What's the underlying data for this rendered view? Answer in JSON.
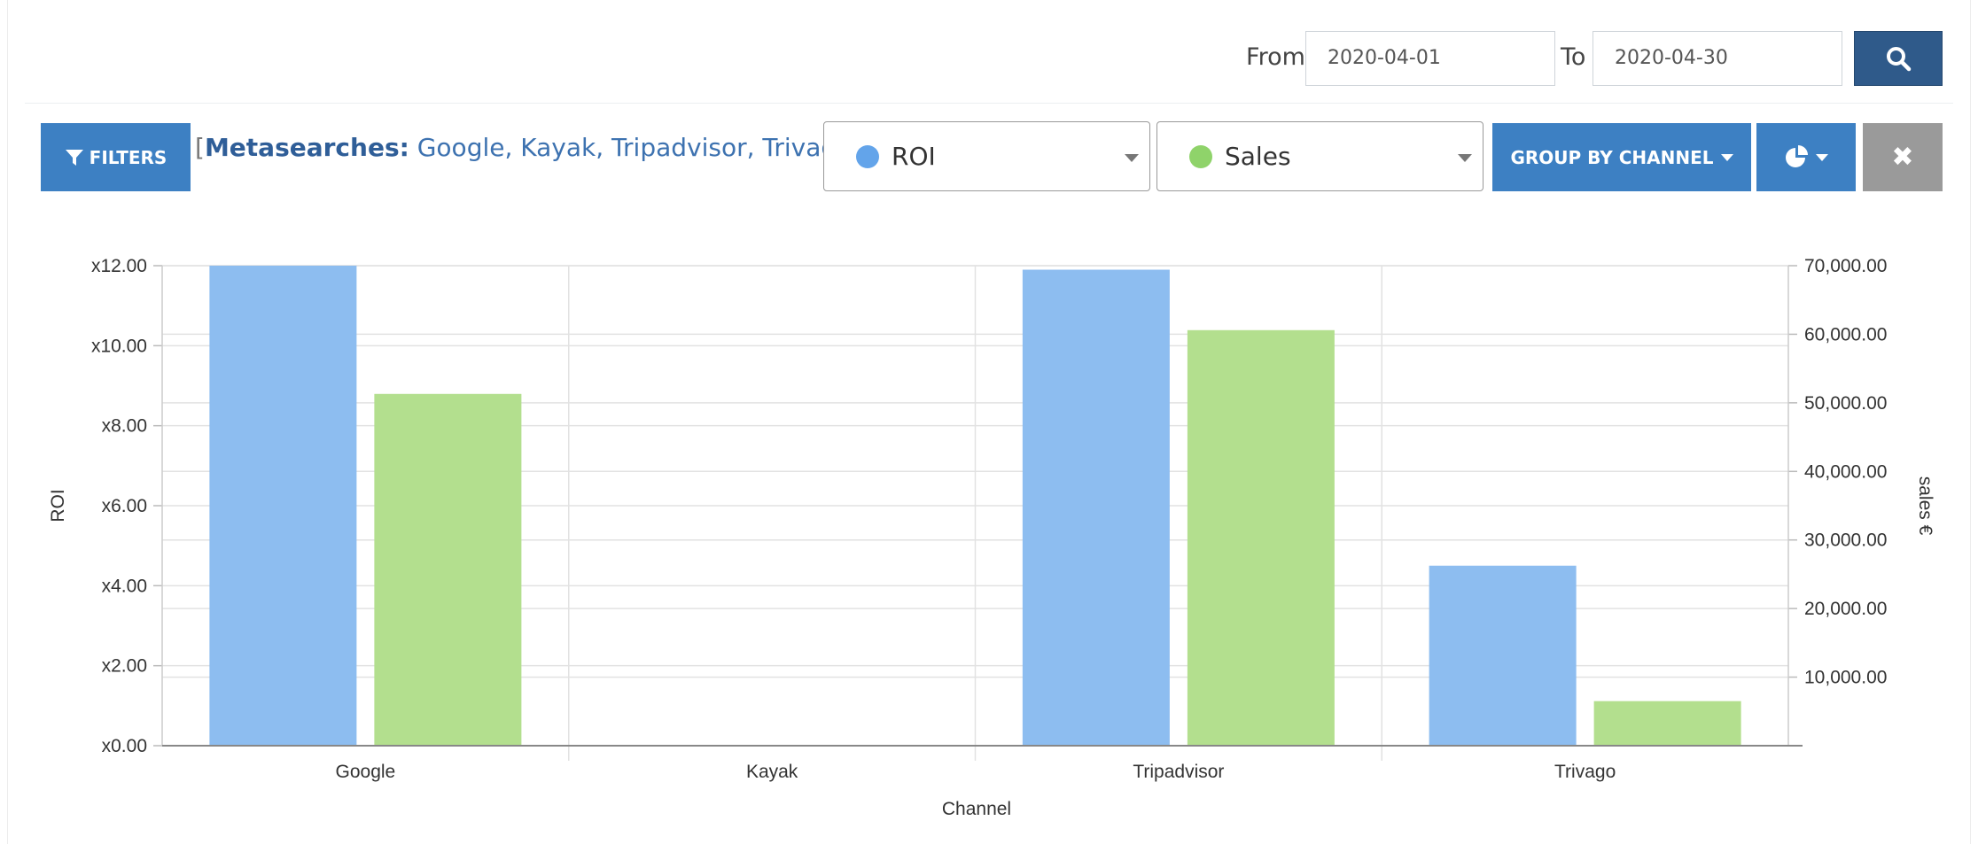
{
  "date_range": {
    "from_label": "From",
    "from_value": "2020-04-01",
    "to_label": "To",
    "to_value": "2020-04-30"
  },
  "filters": {
    "button_label": "FILTERS",
    "open_bracket": "[",
    "key": "Metasearches:",
    "value": " Google, Kayak, Tripadvisor, Trivago",
    "close_bracket": "]"
  },
  "metric_selects": [
    {
      "label": "ROI",
      "color": "#63a4ea"
    },
    {
      "label": "Sales",
      "color": "#8fd36a"
    }
  ],
  "group_by": {
    "label": "GROUP BY CHANNEL"
  },
  "close_label": "✖",
  "colors": {
    "accent": "#3d80c3",
    "search": "#2f5a8a",
    "roi_bar": "#8dbdf0",
    "sales_bar": "#b3df8e"
  },
  "chart_data": {
    "type": "bar",
    "categories": [
      "Google",
      "Kayak",
      "Tripadvisor",
      "Trivago"
    ],
    "series": [
      {
        "values": [
          12.0,
          0,
          11.9,
          4.5
        ],
        "axis": "left"
      },
      {
        "values": [
          51300,
          0,
          60600,
          6500
        ],
        "axis": "right"
      }
    ],
    "xlabel": "Channel",
    "ylabel_left": "ROI",
    "ylabel_right": "sales €",
    "ylim_left": [
      0,
      12
    ],
    "ylim_right": [
      0,
      70000
    ],
    "yticks_left": [
      "x0.00",
      "x2.00",
      "x4.00",
      "x6.00",
      "x8.00",
      "x10.00",
      "x12.00"
    ],
    "yticks_right": [
      "10,000.00",
      "20,000.00",
      "30,000.00",
      "40,000.00",
      "50,000.00",
      "60,000.00",
      "70,000.00"
    ],
    "grid": true
  }
}
